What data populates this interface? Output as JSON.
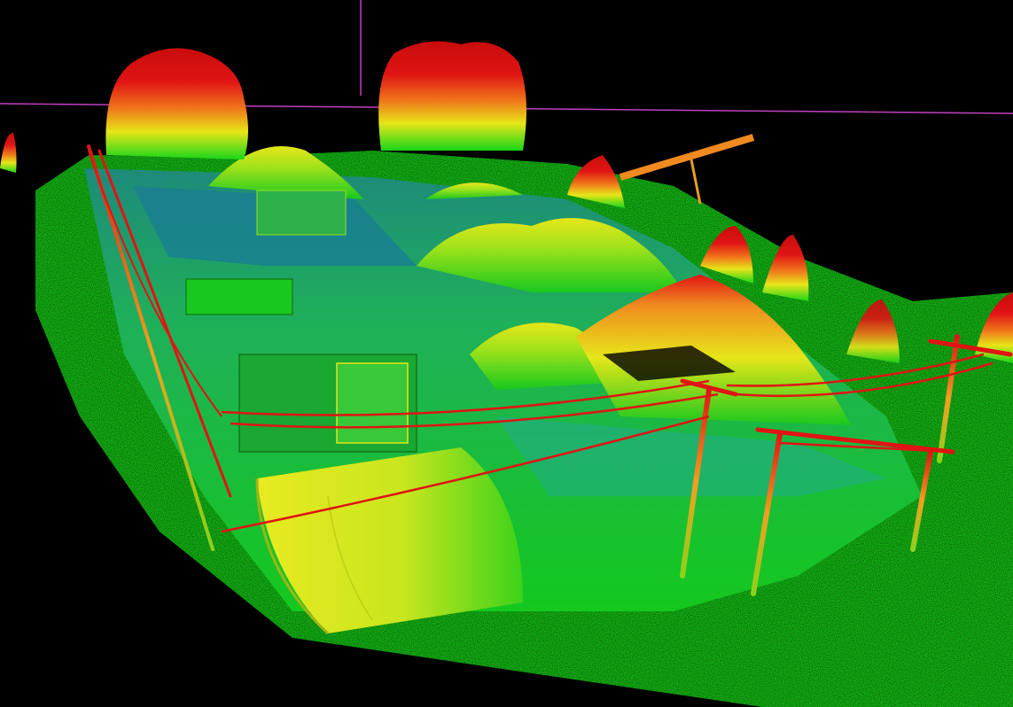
{
  "scene": {
    "kind": "lidar-point-cloud-height-colored",
    "subject": "industrial-yard-with-stockpiles-trees-and-power-lines",
    "colormap": [
      "#0a4a8c",
      "#1fa36b",
      "#19d619",
      "#9fe21a",
      "#e6e619",
      "#f0a020",
      "#e01414"
    ],
    "background": "#000000",
    "bounding_box_color": "#c040c0"
  }
}
